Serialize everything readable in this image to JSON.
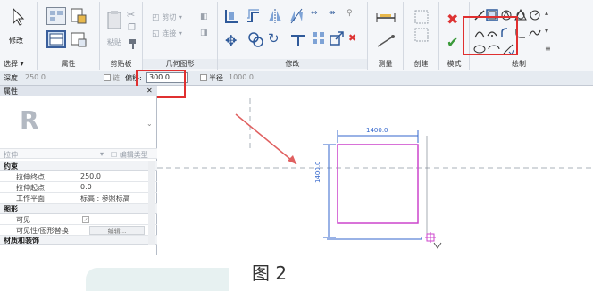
{
  "ribbon": {
    "select": {
      "modify_label": "修改",
      "panel_label": "选择 ▾"
    },
    "properties": {
      "panel_label": "属性"
    },
    "clipboard": {
      "paste_label": "粘贴",
      "panel_label": "剪贴板"
    },
    "geometry": {
      "cut_label": "剪切",
      "join_label": "连接",
      "panel_label": "几何图形"
    },
    "modify": {
      "panel_label": "修改"
    },
    "measure": {
      "panel_label": "测量"
    },
    "create": {
      "panel_label": "创建"
    },
    "mode": {
      "panel_label": "模式"
    },
    "draw": {
      "panel_label": "绘制"
    }
  },
  "options_bar": {
    "depth_label": "深度",
    "depth_value": "250.0",
    "chain_label": "链",
    "offset_label": "偏移:",
    "offset_value": "300.0",
    "radius_label": "半径",
    "radius_value": "1000.0"
  },
  "properties": {
    "title": "属性",
    "close": "✕",
    "type_name": "拉伸",
    "edit_type": "编辑类型",
    "groups": {
      "constraints": "约束",
      "graphics": "图形",
      "materials": "材质和装饰"
    },
    "rows": [
      {
        "label": "拉伸终点",
        "value": "250.0"
      },
      {
        "label": "拉伸起点",
        "value": "0.0"
      },
      {
        "label": "工作平面",
        "value": "标高 : 参照标高"
      }
    ],
    "visible_label": "可见",
    "visibility_label": "可见性/图形替换",
    "visibility_button": "编辑..."
  },
  "canvas": {
    "dim_horizontal": "1400.0",
    "dim_vertical": "1400.0"
  },
  "colors": {
    "sketch": "#cc44cc",
    "dimension": "#3366cc",
    "highlight": "#e03030",
    "arrow": "#e06060"
  },
  "caption": "图 2"
}
